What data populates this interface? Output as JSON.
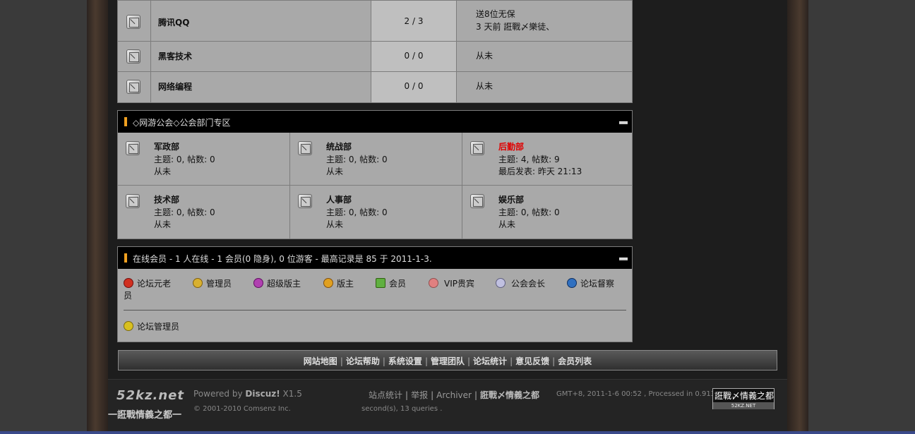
{
  "forums": [
    {
      "name": "腾讯QQ",
      "count": "2 / 3",
      "last_line1": "送8位无保",
      "last_line2": "3 天前  誑戰〆樂徒、"
    },
    {
      "name": "黑客技术",
      "count": "0 / 0",
      "last_line1": "从未",
      "last_line2": ""
    },
    {
      "name": "网络编程",
      "count": "0 / 0",
      "last_line1": "从未",
      "last_line2": ""
    }
  ],
  "category": {
    "title": "◇网游公会◇公会部门专区",
    "cells": [
      {
        "name": "军政部",
        "stats": "主题: 0, 帖数: 0",
        "last": "从未",
        "hot": false
      },
      {
        "name": "统战部",
        "stats": "主题: 0, 帖数: 0",
        "last": "从未",
        "hot": false
      },
      {
        "name": "后勤部",
        "stats": "主题: 4, 帖数: 9",
        "last": "最后发表: 昨天 21:13",
        "hot": true
      },
      {
        "name": "技术部",
        "stats": "主题: 0, 帖数: 0",
        "last": "从未",
        "hot": false
      },
      {
        "name": "人事部",
        "stats": "主题: 0, 帖数: 0",
        "last": "从未",
        "hot": false
      },
      {
        "name": "娱乐部",
        "stats": "主题: 0, 帖数: 0",
        "last": "从未",
        "hot": false
      }
    ]
  },
  "online": {
    "title": "在线会员 - 1 人在线 - 1 会员(0 隐身), 0 位游客 - 最高记录是 85 于 2011-1-3.",
    "legend": [
      {
        "label": "论坛元老",
        "color": "#d03020",
        "wrap": "员"
      },
      {
        "label": "管理员",
        "color": "#d8b030"
      },
      {
        "label": "超级版主",
        "color": "#b040b0"
      },
      {
        "label": "版主",
        "color": "#e0a020"
      },
      {
        "label": "会员",
        "color": "#60b040"
      },
      {
        "label": "VIP贵宾",
        "color": "#e08080"
      },
      {
        "label": "公会会长",
        "color": "#c0c0e0"
      },
      {
        "label": "论坛督察",
        "color": "#3070c0"
      }
    ],
    "second": "论坛管理员"
  },
  "nav": [
    "网站地图",
    "论坛帮助",
    "系统设置",
    "管理团队",
    "论坛统计",
    "意见反馈",
    "会员列表"
  ],
  "footer": {
    "logo": "52kz.net",
    "logo_sub": "一誑戰情義之都一",
    "powered_prefix": "Powered by ",
    "powered_brand": "Discuz!",
    "powered_version": " X1.5",
    "copyright": "© 2001-2010 Comsenz Inc.",
    "links": [
      "站点统计",
      "举报",
      "Archiver"
    ],
    "site_link": "誑戰〆情義之都",
    "gmt": "GMT+8, 2011-1-6 00:52 , Processed in 0.913888",
    "gmt2": "second(s), 13 queries .",
    "badge_top": "誑戰〆情義之都",
    "badge_bottom": "52KZ.NET"
  }
}
